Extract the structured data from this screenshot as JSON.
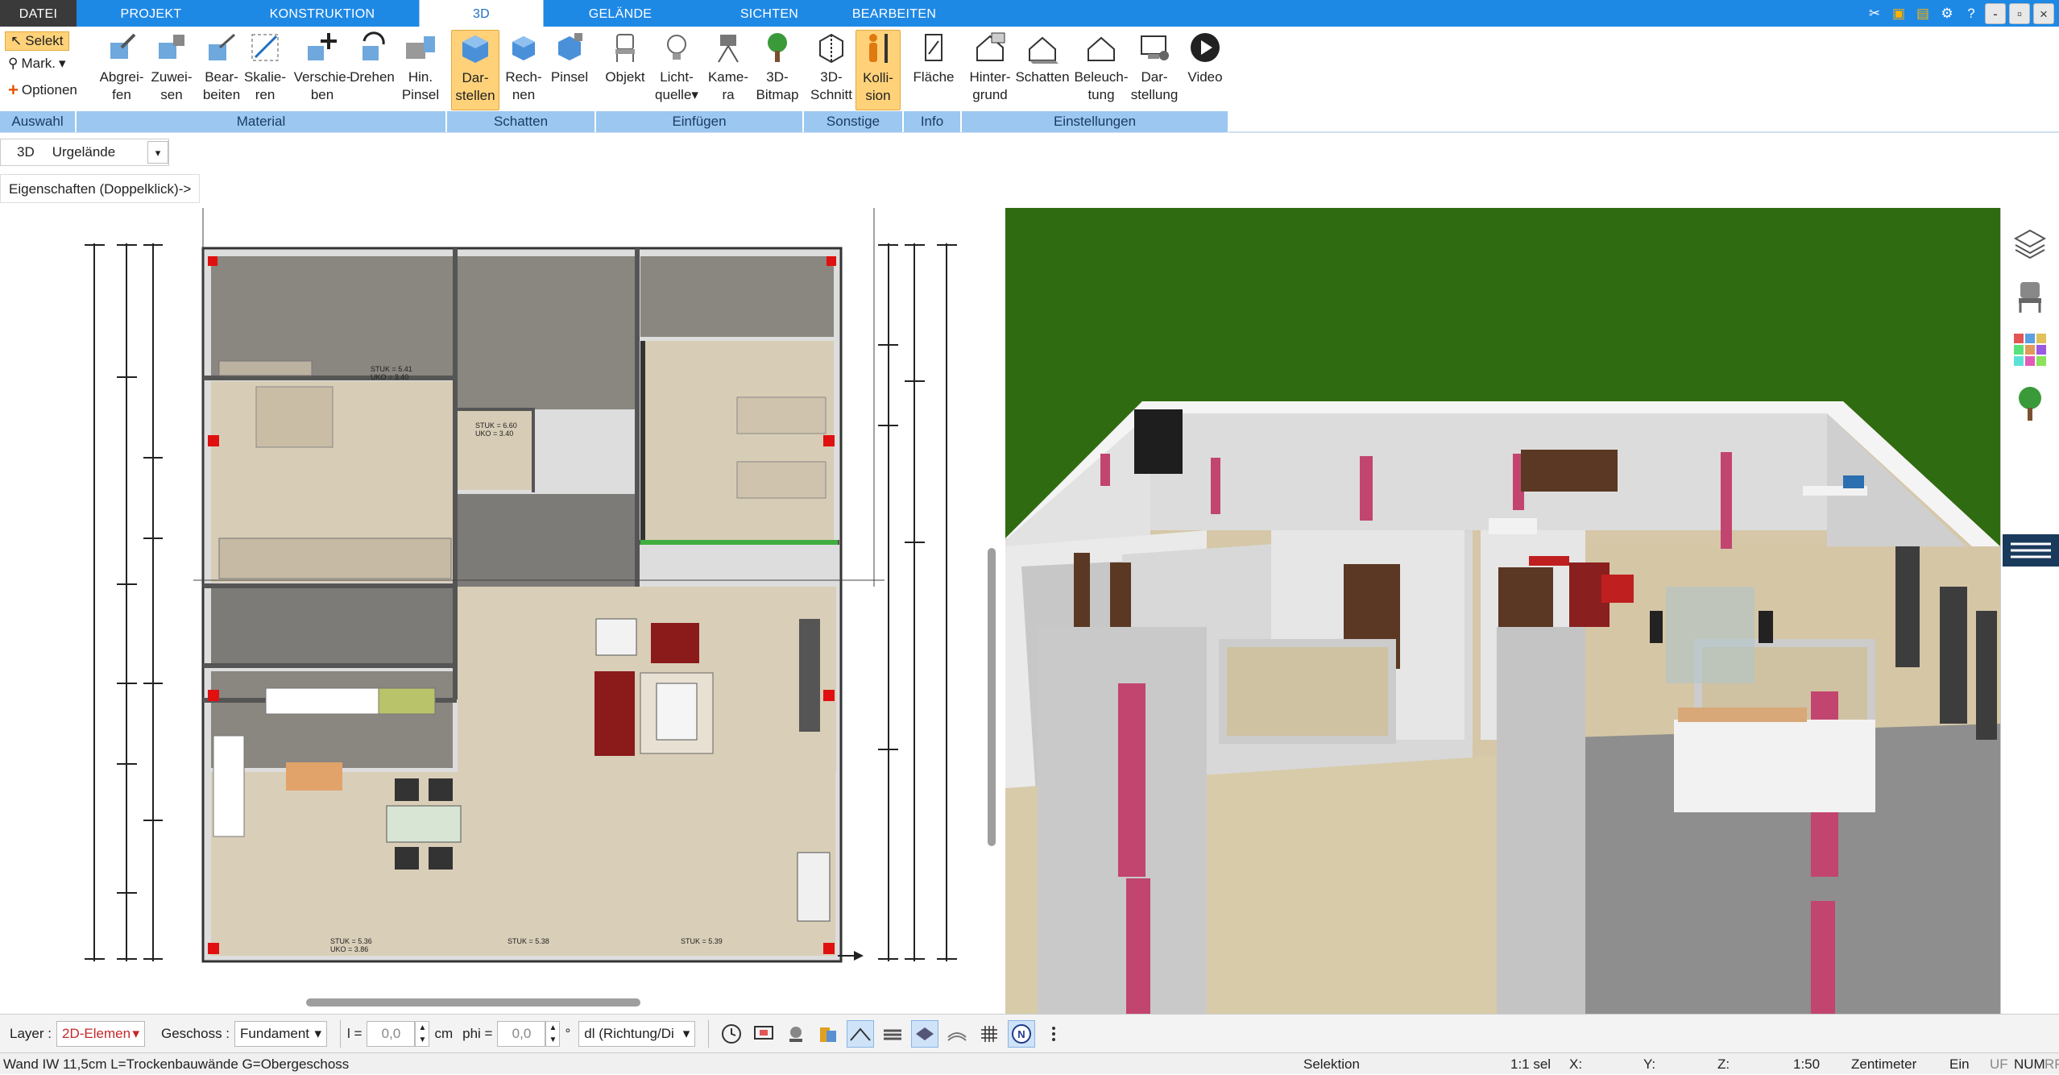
{
  "tabs": [
    {
      "label": "DATEI"
    },
    {
      "label": "PROJEKT"
    },
    {
      "label": "KONSTRUKTION"
    },
    {
      "label": "3D"
    },
    {
      "label": "GELÄNDE"
    },
    {
      "label": "SICHTEN"
    },
    {
      "label": "BEARBEITEN"
    }
  ],
  "active_tab": "3D",
  "window_buttons": {
    "minimize": "-",
    "restore": "▫",
    "close": "×",
    "help": "?"
  },
  "auswahl": {
    "select": "Selekt",
    "mark": "Mark.",
    "options": "Optionen",
    "label": "Auswahl"
  },
  "groups": {
    "material": "Material",
    "schatten": "Schatten",
    "einfuegen": "Einfügen",
    "sonstige": "Sonstige",
    "info": "Info",
    "einstellungen": "Einstellungen"
  },
  "buttons": {
    "abgreifen": [
      "Abgrei-",
      "fen"
    ],
    "zuweisen": [
      "Zuwei-",
      "sen"
    ],
    "bearbeiten": [
      "Bear-",
      "beiten"
    ],
    "skalieren": [
      "Skalie-",
      "ren"
    ],
    "verschieben": [
      "Verschie-",
      "ben"
    ],
    "drehen": [
      "Drehen",
      ""
    ],
    "hin_pinsel": [
      "Hin.",
      "Pinsel"
    ],
    "darstellen": [
      "Dar-",
      "stellen"
    ],
    "rechnen": [
      "Rech-",
      "nen"
    ],
    "pinsel": [
      "Pinsel",
      ""
    ],
    "objekt": [
      "Objekt",
      ""
    ],
    "lichtquelle": [
      "Licht-",
      "quelle"
    ],
    "kamera": [
      "Kame-",
      "ra"
    ],
    "bitmap": [
      "3D-",
      "Bitmap"
    ],
    "schnitt": [
      "3D-",
      "Schnitt"
    ],
    "kollision": [
      "Kolli-",
      "sion"
    ],
    "flaeche": [
      "Fläche",
      ""
    ],
    "hintergrund": [
      "Hinter-",
      "grund"
    ],
    "schatten": [
      "Schatten",
      ""
    ],
    "beleuchtung": [
      "Beleuch-",
      "tung"
    ],
    "darstellung": [
      "Dar-",
      "stellung"
    ],
    "video": [
      "Video",
      ""
    ]
  },
  "subbar": {
    "mode": "3D",
    "terrain": "Urgelände"
  },
  "properties_hint": "Eigenschaften (Doppelklick)->",
  "plan_labels": {
    "rooms": [
      "STUK = 5.41",
      "UKO = 3.40",
      "STUK = 6.60",
      "UKO = 3.40",
      "STUK = 5.36",
      "UKO = 3.86",
      "STUK = 5.38",
      "STUK = 5.39"
    ]
  },
  "toolbar": {
    "layer_label": "Layer :",
    "layer_value": "2D-Elemen",
    "geschoss_label": "Geschoss :",
    "geschoss_value": "Fundament",
    "l_label": "l =",
    "l_value": "0,0",
    "l_unit": "cm",
    "phi_label": "phi =",
    "phi_value": "0,0",
    "phi_unit": "°",
    "direction": "dl (Richtung/Di"
  },
  "status": {
    "left": "Wand IW 11,5cm L=Trockenbauwände G=Obergeschoss",
    "mode": "Selektion",
    "sel": "1:1 sel",
    "x": "X:",
    "y": "Y:",
    "z": "Z:",
    "scale": "1:50",
    "unit": "Zentimeter",
    "ein": "Ein",
    "uf": "UF",
    "num": "NUM",
    "rf": "RF"
  },
  "colors": {
    "ribbon_blue": "#1e88e5",
    "group_label": "#9cc7f0",
    "highlight": "#ffd27a",
    "grass": "#2f6b10",
    "column_pink": "#c2456f"
  }
}
